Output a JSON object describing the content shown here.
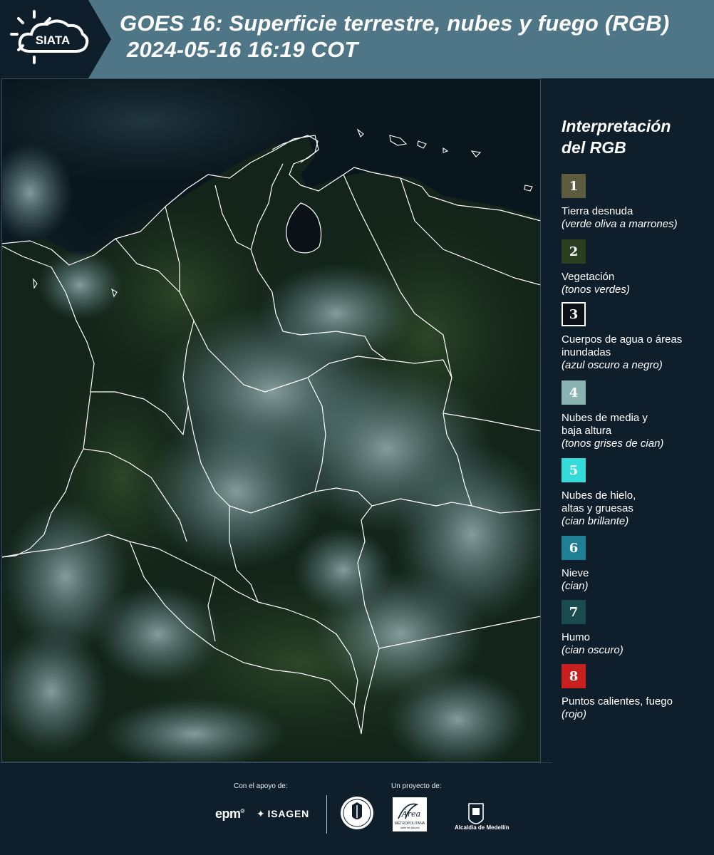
{
  "header": {
    "logo_text": "SIATA",
    "title_line1": "GOES 16: Superficie terrestre, nubes y fuego (RGB)",
    "title_line2": "2024-05-16 16:19 COT",
    "bar_color": "#4f7687",
    "logo_bg": "#0e1f2b"
  },
  "legend": {
    "heading_line1": "Interpretación",
    "heading_line2": "del RGB",
    "items": [
      {
        "number": "1",
        "label": "Tierra desnuda",
        "detail": "(verde oliva a marrones)",
        "color": "#5d5b40",
        "border": "#5d5b40"
      },
      {
        "number": "2",
        "label": "Vegetación",
        "detail": "(tonos verdes)",
        "color": "#2c3e20",
        "border": "#2c3e20"
      },
      {
        "number": "3",
        "label": "Cuerpos de agua o áreas inundadas",
        "detail": "(azul oscuro a negro)",
        "color": "#0b1117",
        "border": "#ffffff"
      },
      {
        "number": "4",
        "label": "Nubes de media y baja altura",
        "detail": "(tonos grises de cian)",
        "color": "#89b2b1",
        "border": "#89b2b1"
      },
      {
        "number": "5",
        "label": "Nubes de hielo, altas y gruesas",
        "detail": "(cian brillante)",
        "color": "#34dbd8",
        "border": "#34dbd8"
      },
      {
        "number": "6",
        "label": "Nieve",
        "detail": "(cian)",
        "color": "#1e7f95",
        "border": "#1e7f95"
      },
      {
        "number": "7",
        "label": "Humo",
        "detail": "(cian oscuro)",
        "color": "#1a4b4d",
        "border": "#1a4b4d"
      },
      {
        "number": "8",
        "label": "Puntos calientes, fuego",
        "detail": "(rojo)",
        "color": "#c8201f",
        "border": "#c8201f"
      }
    ]
  },
  "footer": {
    "support_label": "Con el apoyo de:",
    "project_label": "Un proyecto de:",
    "epm_text": "epm",
    "isagen_text": "ISAGEN",
    "area_text": "Área",
    "area_sub": "METROPOLITANA",
    "area_sub2": "Valle de Aburrá",
    "alcaldia_text": "Alcaldía de Medellín"
  }
}
